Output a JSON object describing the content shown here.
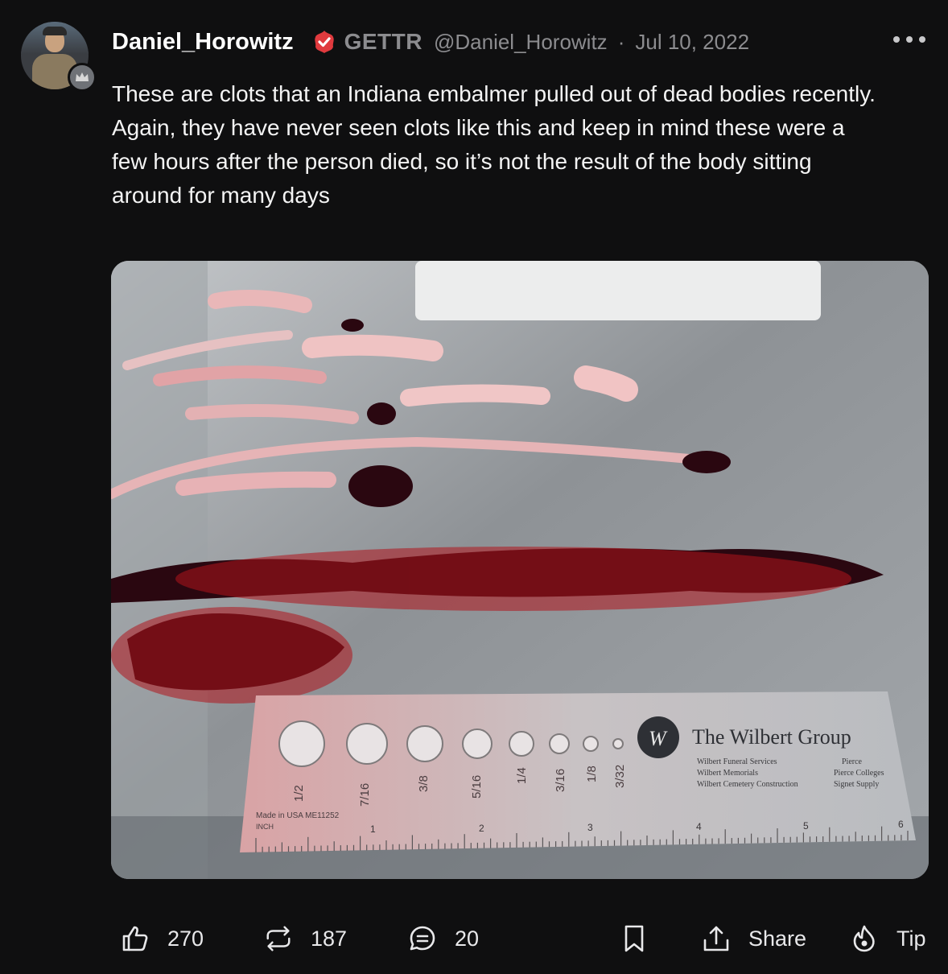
{
  "post": {
    "username": "Daniel_Horowitz",
    "brand": "GETTR",
    "handle": "@Daniel_Horowitz",
    "separator": "·",
    "date": "Jul 10, 2022",
    "text": "These are clots that an Indiana embalmer pulled out of dead bodies recently. Again, they have never seen clots like this and keep in mind these were a few hours after the person died, so it’s not the result of the body sitting around for many days"
  },
  "image": {
    "ruler_brand": "The Wilbert Group",
    "ruler_lines": [
      "Wilbert Funeral Services",
      "Wilbert Memorials",
      "Wilbert Cemetery Construction"
    ],
    "ruler_lines_right": [
      "Pierce",
      "Pierce Colleges",
      "Signet Supply"
    ],
    "hole_labels": [
      "1/2",
      "7/16",
      "3/8",
      "5/16",
      "1/4",
      "3/16",
      "1/8",
      "3/32"
    ],
    "made_in": "Made in USA  ME11252",
    "inch_label": "INCH",
    "ruler_numbers": [
      "1",
      "2",
      "3",
      "4",
      "5",
      "6"
    ]
  },
  "actions": {
    "likes": "270",
    "reposts": "187",
    "comments": "20",
    "share_label": "Share",
    "tip_label": "Tip"
  },
  "colors": {
    "background": "#0f0f10",
    "verified": "#e03a3e",
    "muted_text": "#8c8c8f"
  },
  "icons": [
    "verified-icon",
    "more-icon",
    "like-icon",
    "repost-icon",
    "comment-icon",
    "bookmark-icon",
    "share-icon",
    "tip-icon"
  ]
}
